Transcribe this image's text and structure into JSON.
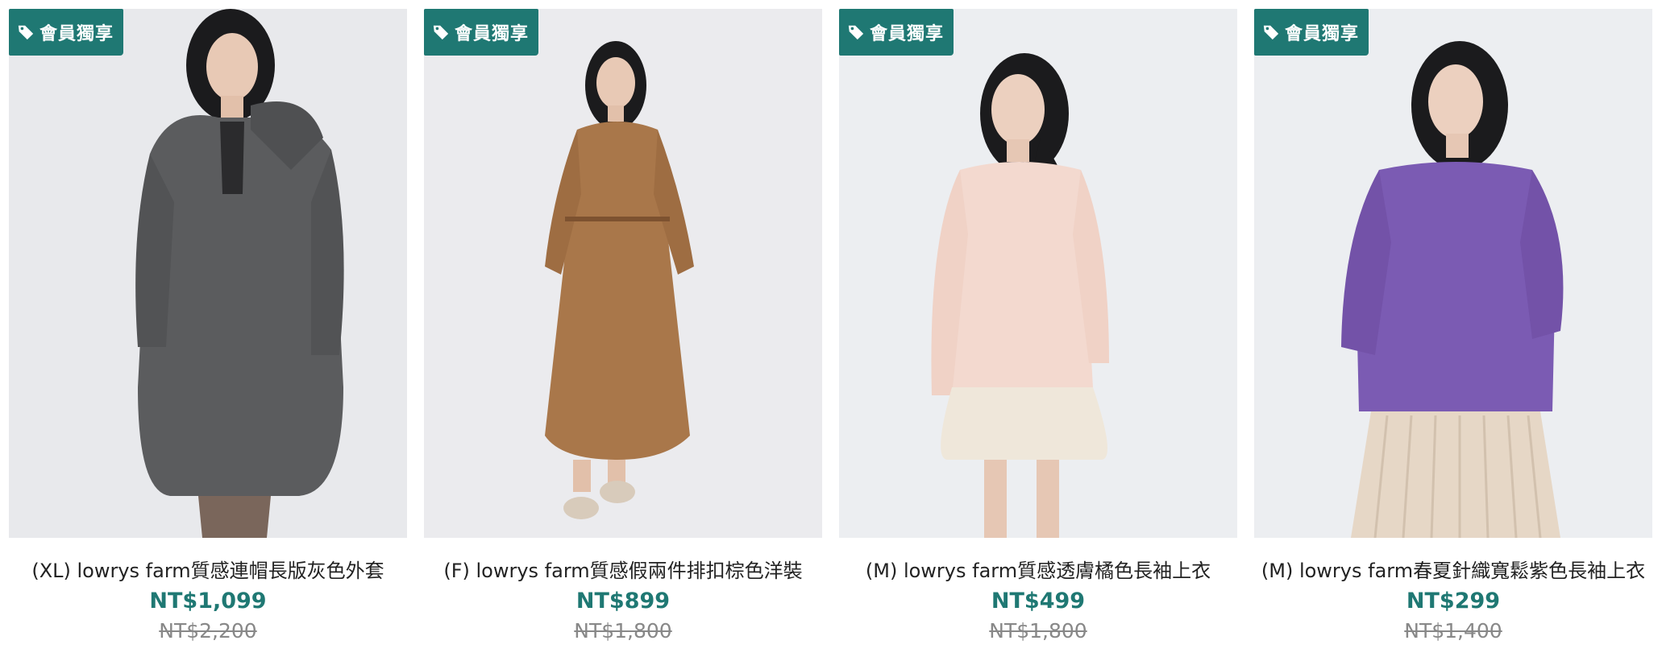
{
  "products": [
    {
      "badge": "會員獨享",
      "name": "(XL) lowrys farm質感連帽長版灰色外套",
      "price": "NT$1,099",
      "original_price": "NT$2,200",
      "photo_desc": "gray hooded long coat",
      "garment_color": "#5b5c5e"
    },
    {
      "badge": "會員獨享",
      "name": "(F) lowrys farm質感假兩件排扣棕色洋裝",
      "price": "NT$899",
      "original_price": "NT$1,800",
      "photo_desc": "brown button dress",
      "garment_color": "#a9774a"
    },
    {
      "badge": "會員獨享",
      "name": "(M) lowrys farm質感透膚橘色長袖上衣",
      "price": "NT$499",
      "original_price": "NT$1,800",
      "photo_desc": "sheer peach long-sleeve blouse",
      "garment_color": "#f3d9cf"
    },
    {
      "badge": "會員獨享",
      "name": "(M) lowrys farm春夏針織寬鬆紫色長袖上衣",
      "price": "NT$299",
      "original_price": "NT$1,400",
      "photo_desc": "purple loose knit top",
      "garment_color": "#7b5bb3"
    }
  ],
  "theme": {
    "accent": "#1f7873",
    "photo_bg": "#e9eaed"
  },
  "icons": {
    "badge_icon": "tag-icon"
  }
}
